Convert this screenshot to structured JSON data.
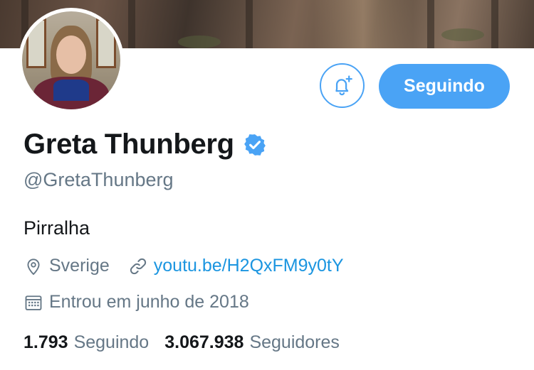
{
  "profile": {
    "name": "Greta Thunberg",
    "handle": "@GretaThunberg",
    "bio": "Pirralha",
    "location": "Sverige",
    "website": "youtu.be/H2QxFM9y0tY",
    "joined": "Entrou em junho de 2018",
    "verified": true
  },
  "actions": {
    "follow_label": "Seguindo",
    "notify_icon": "bell-plus-icon"
  },
  "stats": {
    "following_count": "1.793",
    "following_label": "Seguindo",
    "followers_count": "3.067.938",
    "followers_label": "Seguidores"
  },
  "colors": {
    "accent": "#4aa3f5",
    "link": "#1b95e0",
    "secondary_text": "#657786",
    "primary_text": "#14171a"
  }
}
